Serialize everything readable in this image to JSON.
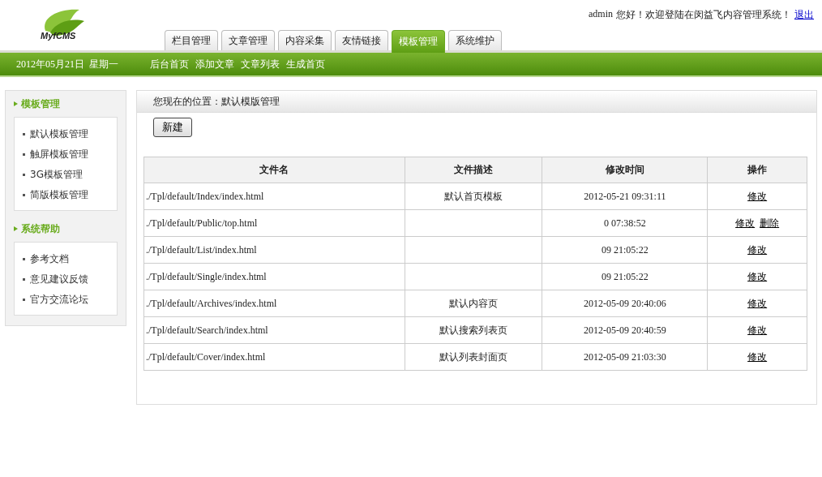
{
  "logo": {
    "text": "MyfCMS"
  },
  "welcome": {
    "user": "admin",
    "message": "您好！欢迎登陆在闵益飞内容管理系统！",
    "logout": "退出"
  },
  "tabs": [
    {
      "label": "栏目管理",
      "selected": false
    },
    {
      "label": "文章管理",
      "selected": false
    },
    {
      "label": "内容采集",
      "selected": false
    },
    {
      "label": "友情链接",
      "selected": false
    },
    {
      "label": "模板管理",
      "selected": true
    },
    {
      "label": "系统维护",
      "selected": false
    }
  ],
  "subbar": {
    "date": "2012年05月21日  星期一",
    "links": [
      "后台首页",
      "添加文章",
      "文章列表",
      "生成首页"
    ]
  },
  "sidebar": [
    {
      "title": "模板管理",
      "items": [
        "默认模板管理",
        "触屏模板管理",
        "3G模板管理",
        "简版模板管理"
      ]
    },
    {
      "title": "系统帮助",
      "items": [
        "参考文档",
        "意见建议反馈",
        "官方交流论坛"
      ]
    }
  ],
  "breadcrumb": "您现在的位置：默认模版管理",
  "new_button": "新建",
  "table": {
    "columns": [
      "文件名",
      "文件描述",
      "修改时间",
      "操作"
    ],
    "rows": [
      {
        "file": "./Tpl/default/Index/index.html",
        "description": "默认首页模板",
        "time": "2012-05-21 09:31:11",
        "actions": [
          "修改"
        ]
      },
      {
        "file": "./Tpl/default/Public/top.html",
        "time": "0 07:38:52",
        "actions": [
          "修改",
          "删除"
        ]
      },
      {
        "file": "./Tpl/default/List/index.html",
        "time": "09 21:05:22",
        "actions": [
          "修改"
        ]
      },
      {
        "file": "./Tpl/default/Single/index.html",
        "time": "09 21:05:22",
        "actions": [
          "修改"
        ]
      },
      {
        "file": "./Tpl/default/Archives/index.html",
        "description": "默认内容页",
        "time": "2012-05-09 20:40:06",
        "actions": [
          "修改"
        ]
      },
      {
        "file": "./Tpl/default/Search/index.html",
        "description": "默认搜索列表页",
        "time": "2012-05-09 20:40:59",
        "actions": [
          "修改"
        ]
      },
      {
        "file": "./Tpl/default/Cover/index.html",
        "description": "默认列表封面页",
        "time": "2012-05-09 21:03:30",
        "actions": [
          "修改"
        ]
      }
    ]
  }
}
